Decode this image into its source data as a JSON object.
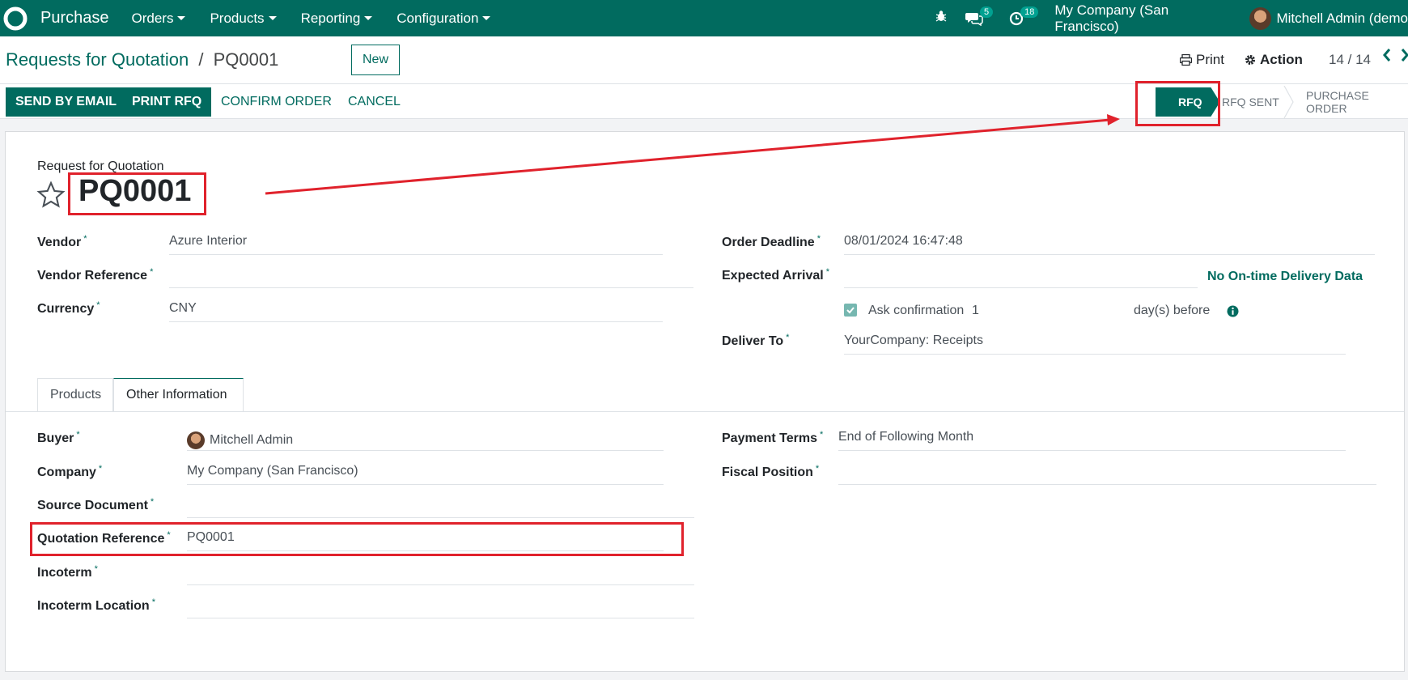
{
  "topnav": {
    "app_name": "Purchase",
    "menus": [
      "Orders",
      "Products",
      "Reporting",
      "Configuration"
    ],
    "messages_count": "5",
    "activities_count": "18",
    "company": "My Company (San Francisco)",
    "user": "Mitchell Admin (demo"
  },
  "control_panel": {
    "breadcrumb_parent": "Requests for Quotation",
    "breadcrumb_sep": "/",
    "breadcrumb_current": "PQ0001",
    "new_label": "New",
    "print_label": "Print",
    "action_label": "Action",
    "pager": "14 / 14"
  },
  "statusbar": {
    "send_email": "SEND BY EMAIL",
    "print_rfq": "PRINT RFQ",
    "confirm_order": "CONFIRM ORDER",
    "cancel": "CANCEL",
    "stages": [
      "RFQ",
      "RFQ SENT",
      "PURCHASE ORDER"
    ],
    "active_stage": "RFQ"
  },
  "form": {
    "title_label": "Request for Quotation",
    "name": "PQ0001",
    "vendor_label": "Vendor",
    "vendor": "Azure Interior",
    "vendor_ref_label": "Vendor Reference",
    "currency_label": "Currency",
    "currency": "CNY",
    "order_deadline_label": "Order Deadline",
    "order_deadline": "08/01/2024 16:47:48",
    "expected_arrival_label": "Expected Arrival",
    "on_time_label": "No On-time Delivery Data",
    "ask_confirmation_label": "Ask confirmation",
    "ask_confirmation_days": "1",
    "days_before_label": "day(s) before",
    "deliver_to_label": "Deliver To",
    "deliver_to": "YourCompany: Receipts",
    "tabs": [
      "Products",
      "Other Information"
    ],
    "active_tab": "Other Information",
    "buyer_label": "Buyer",
    "buyer": "Mitchell Admin",
    "company_label": "Company",
    "company": "My Company (San Francisco)",
    "source_doc_label": "Source Document",
    "quotation_ref_label": "Quotation Reference",
    "quotation_ref": "PQ0001",
    "incoterm_label": "Incoterm",
    "incoterm_location_label": "Incoterm Location",
    "payment_terms_label": "Payment Terms",
    "payment_terms": "End of Following Month",
    "fiscal_position_label": "Fiscal Position",
    "required_mark": "*"
  },
  "colors": {
    "brand": "#016b5f",
    "annotation": "#e0222c"
  }
}
